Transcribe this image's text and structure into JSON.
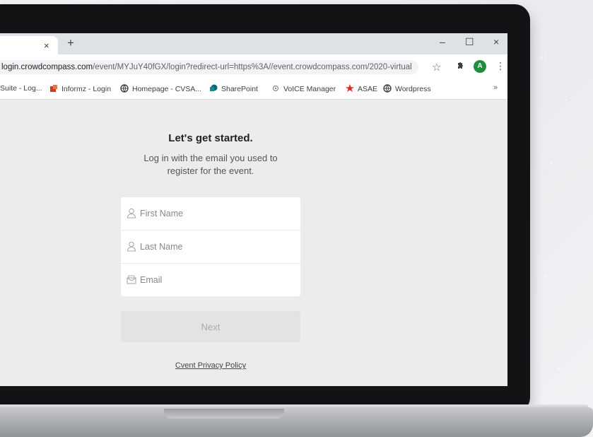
{
  "browser": {
    "tab_close": "×",
    "new_tab": "+",
    "window_controls": {
      "minimize": "–",
      "maximize": "☐",
      "close": "×"
    },
    "url_host": "login.crowdcompass.com",
    "url_path": "/event/MYJuY40fGX/login?redirect-url=https%3A//event.crowdcompass.com/2020-virtual",
    "profile_initial": "A",
    "menu": "⋮",
    "bookmarks_more": "»",
    "bookmarks": [
      {
        "label": "Suite - Log...",
        "icon": "none"
      },
      {
        "label": "Informz - Login",
        "icon": "informz-icon"
      },
      {
        "label": "Homepage - CVSA...",
        "icon": "globe-icon"
      },
      {
        "label": "SharePoint",
        "icon": "sharepoint-icon"
      },
      {
        "label": "VoICE Manager",
        "icon": "gear-icon"
      },
      {
        "label": "ASAE",
        "icon": "asae-icon"
      },
      {
        "label": "Wordpress",
        "icon": "globe-icon"
      }
    ]
  },
  "login": {
    "heading": "Let's get started.",
    "subheading_line1": "Log in with the email you used to",
    "subheading_line2": "register for the event.",
    "first_name_placeholder": "First Name",
    "last_name_placeholder": "Last Name",
    "email_placeholder": "Email",
    "next_label": "Next",
    "privacy_link": "Cvent Privacy Policy"
  },
  "colors": {
    "profile_avatar": "#1e8e3e",
    "asae_icon": "#d93025",
    "sharepoint_icon": "#0b6a6f",
    "informz_icon": "#c8401a"
  }
}
